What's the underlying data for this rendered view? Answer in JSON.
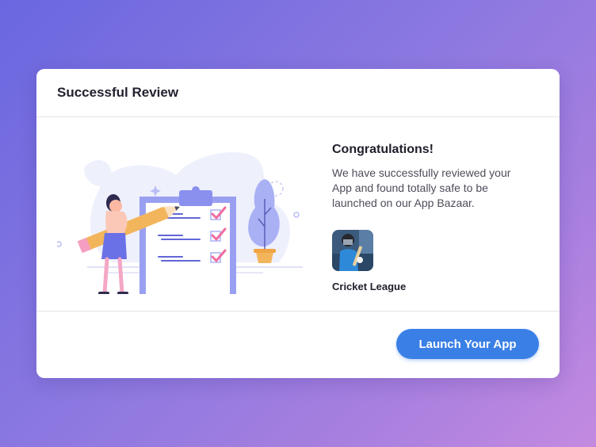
{
  "dialog": {
    "title": "Successful Review",
    "heading": "Congratulations!",
    "message": "We have successfully reviewed your App and found totally safe to be launched on our App Bazaar.",
    "app": {
      "name": "Cricket League",
      "icon": "cricket-player-photo"
    },
    "primary_action": "Launch Your App"
  },
  "colors": {
    "background_gradient": [
      "#6a67e0",
      "#c48ae0"
    ],
    "accent": "#3a7fe6",
    "illustration_primary": "#8a90ee",
    "illustration_pink": "#f06ba0"
  }
}
